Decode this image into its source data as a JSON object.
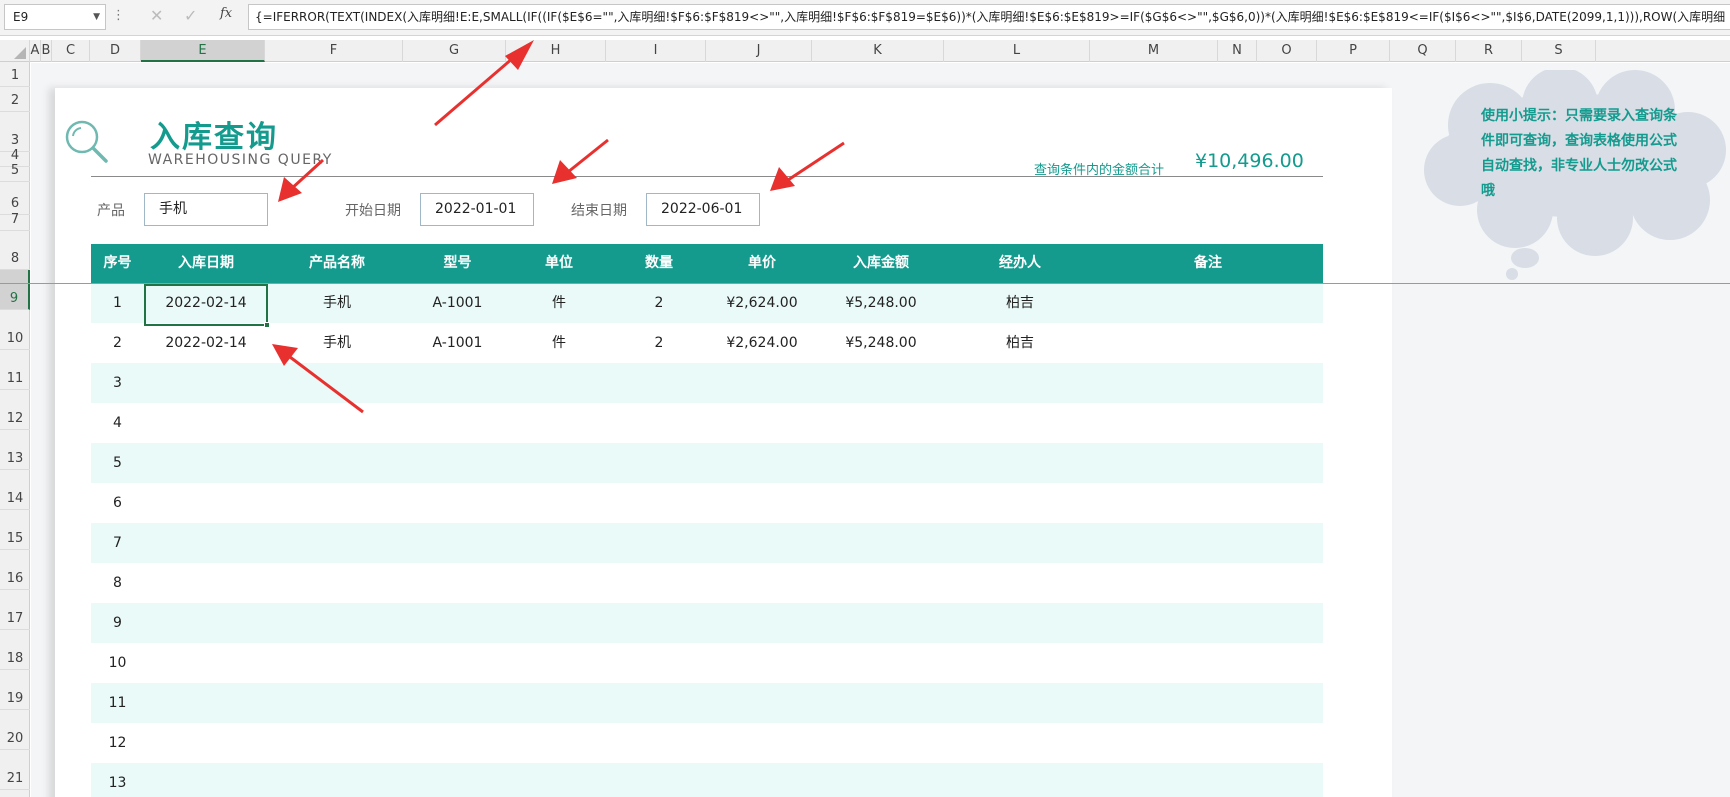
{
  "formula_bar": {
    "cell_ref": "E9",
    "cancel_icon": "✕",
    "enter_icon": "✓",
    "fx_label": "fx",
    "formula": "{=IFERROR(TEXT(INDEX(入库明细!E:E,SMALL(IF((IF($E$6=\"\",入库明细!$F$6:$F$819<>\"\",入库明细!$F$6:$F$819=$E$6))*(入库明细!$E$6:$E$819>=IF($G$6<>\"\",$G$6,0))*(入库明细!$E$6:$E$819<=IF($I$6<>\"\",$I$6,DATE(2099,1,1))),ROW(入库明细"
  },
  "columns": [
    "A",
    "B",
    "C",
    "D",
    "E",
    "F",
    "G",
    "H",
    "I",
    "J",
    "K",
    "L",
    "M",
    "N",
    "O",
    "P",
    "Q",
    "R",
    "S"
  ],
  "rows": [
    "1",
    "2",
    "3",
    "4",
    "5",
    "6",
    "7",
    "8",
    "9",
    "10",
    "11",
    "12",
    "13",
    "14",
    "15",
    "16",
    "17",
    "18",
    "19",
    "20",
    "21"
  ],
  "selected_column": "E",
  "selected_row": "9",
  "title": {
    "main": "入库查询",
    "sub": "WAREHOUSING  QUERY"
  },
  "summary": {
    "label": "查询条件内的金额合计",
    "value": "¥10,496.00"
  },
  "conditions": {
    "product_label": "产品",
    "product_value": "手机",
    "start_label": "开始日期",
    "start_value": "2022-01-01",
    "end_label": "结束日期",
    "end_value": "2022-06-01"
  },
  "table": {
    "headers": [
      "序号",
      "入库日期",
      "产品名称",
      "型号",
      "单位",
      "数量",
      "单价",
      "入库金额",
      "经办人",
      "备注"
    ],
    "rows": [
      [
        "1",
        "2022-02-14",
        "手机",
        "A-1001",
        "件",
        "2",
        "¥2,624.00",
        "¥5,248.00",
        "柏吉",
        ""
      ],
      [
        "2",
        "2022-02-14",
        "手机",
        "A-1001",
        "件",
        "2",
        "¥2,624.00",
        "¥5,248.00",
        "柏吉",
        ""
      ],
      [
        "3",
        "",
        "",
        "",
        "",
        "",
        "",
        "",
        "",
        ""
      ],
      [
        "4",
        "",
        "",
        "",
        "",
        "",
        "",
        "",
        "",
        ""
      ],
      [
        "5",
        "",
        "",
        "",
        "",
        "",
        "",
        "",
        "",
        ""
      ],
      [
        "6",
        "",
        "",
        "",
        "",
        "",
        "",
        "",
        "",
        ""
      ],
      [
        "7",
        "",
        "",
        "",
        "",
        "",
        "",
        "",
        "",
        ""
      ],
      [
        "8",
        "",
        "",
        "",
        "",
        "",
        "",
        "",
        "",
        ""
      ],
      [
        "9",
        "",
        "",
        "",
        "",
        "",
        "",
        "",
        "",
        ""
      ],
      [
        "10",
        "",
        "",
        "",
        "",
        "",
        "",
        "",
        "",
        ""
      ],
      [
        "11",
        "",
        "",
        "",
        "",
        "",
        "",
        "",
        "",
        ""
      ],
      [
        "12",
        "",
        "",
        "",
        "",
        "",
        "",
        "",
        "",
        ""
      ],
      [
        "13",
        "",
        "",
        "",
        "",
        "",
        "",
        "",
        "",
        ""
      ]
    ]
  },
  "tip": {
    "text": "使用小提示：只需要录入查询条件即可查询，查询表格使用公式自动查找，非专业人士勿改公式哦"
  },
  "icons": {
    "title": "magnifier-icon",
    "annotation": "red-arrow-icon"
  },
  "colors": {
    "accent": "#149b8e",
    "row_alt": "#eafaf8",
    "annotation": "#e8312f",
    "cloud": "#d8dde6"
  }
}
